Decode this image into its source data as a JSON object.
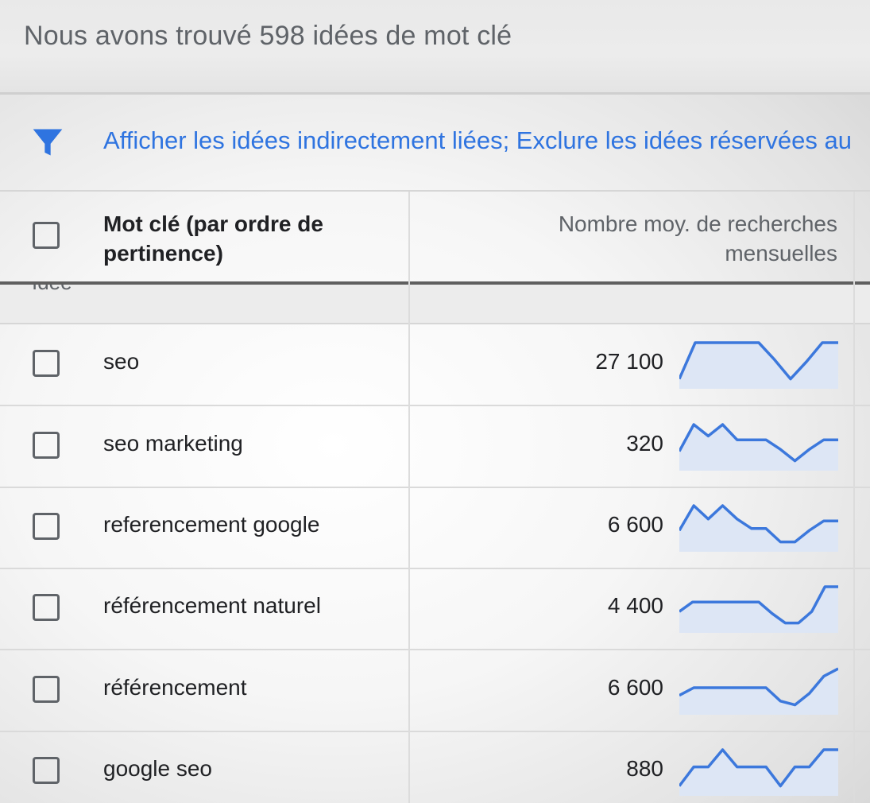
{
  "header": {
    "title": "Nous avons trouvé 598 idées de mot clé"
  },
  "filter": {
    "icon": "filter-icon",
    "text": "Afficher les idées indirectement liées; Exclure les idées réservées au",
    "color": "#2f74e0"
  },
  "table": {
    "columns": {
      "keyword": "Mot clé (par ordre de pertinence)",
      "searches": "Nombre moy. de recherches mensuelles"
    },
    "group_label": "Idée",
    "sparkline_color": "#3c78dc",
    "rows": [
      {
        "keyword": "seo",
        "volume": "27 100",
        "trend": [
          0.05,
          1,
          1,
          1,
          1,
          1,
          0.55,
          0.05,
          0.5,
          1,
          1
        ]
      },
      {
        "keyword": "seo marketing",
        "volume": "320",
        "trend": [
          0.3,
          1,
          0.7,
          1,
          0.6,
          0.6,
          0.6,
          0.35,
          0.05,
          0.35,
          0.6,
          0.6
        ]
      },
      {
        "keyword": "referencement google",
        "volume": "6 600",
        "trend": [
          0.35,
          1,
          0.65,
          1,
          0.65,
          0.4,
          0.4,
          0.05,
          0.05,
          0.35,
          0.6,
          0.6
        ]
      },
      {
        "keyword": "référencement naturel",
        "volume": "4 400",
        "trend": [
          0.35,
          0.6,
          0.6,
          0.6,
          0.6,
          0.6,
          0.6,
          0.3,
          0.05,
          0.05,
          0.35,
          1,
          1
        ]
      },
      {
        "keyword": "référencement",
        "volume": "6 600",
        "trend": [
          0.3,
          0.5,
          0.5,
          0.5,
          0.5,
          0.5,
          0.5,
          0.15,
          0.05,
          0.35,
          0.8,
          1
        ]
      },
      {
        "keyword": "google seo",
        "volume": "880",
        "trend": [
          0.05,
          0.55,
          0.55,
          1,
          0.55,
          0.55,
          0.55,
          0.05,
          0.55,
          0.55,
          1,
          1
        ]
      }
    ]
  }
}
